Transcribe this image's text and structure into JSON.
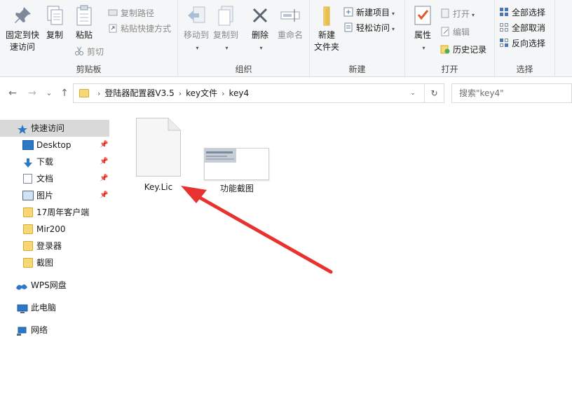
{
  "ribbon": {
    "clipboard": {
      "label": "剪贴板",
      "pin_label_1": "固定到快",
      "pin_label_2": "速访问",
      "copy": "复制",
      "paste": "粘贴",
      "copy_path": "复制路径",
      "paste_shortcut": "粘贴快捷方式",
      "cut": "剪切"
    },
    "organize": {
      "label": "组织",
      "move_to": "移动到",
      "copy_to": "复制到",
      "delete": "删除",
      "rename": "重命名"
    },
    "new": {
      "label": "新建",
      "new_folder_1": "新建",
      "new_folder_2": "文件夹",
      "new_item": "新建项目",
      "easy_access": "轻松访问"
    },
    "open": {
      "label": "打开",
      "properties": "属性",
      "open": "打开",
      "edit": "编辑",
      "history": "历史记录"
    },
    "select": {
      "label": "选择",
      "select_all": "全部选择",
      "select_none": "全部取消",
      "invert": "反向选择"
    }
  },
  "nav": {
    "back": "←",
    "forward": "→",
    "recent": "⌄",
    "up": "↑",
    "breadcrumbs": [
      "登陆器配置器V3.5",
      "key文件",
      "key4"
    ],
    "search_placeholder": "搜索\"key4\""
  },
  "sidebar": {
    "items": [
      {
        "label": "快速访问",
        "icon": "star-icon",
        "selected": true
      },
      {
        "label": "Desktop",
        "icon": "desktop-icon",
        "pinned": true
      },
      {
        "label": "下载",
        "icon": "download-icon",
        "pinned": true
      },
      {
        "label": "文档",
        "icon": "document-icon",
        "pinned": true
      },
      {
        "label": "图片",
        "icon": "picture-icon",
        "pinned": true
      },
      {
        "label": "17周年客户端",
        "icon": "folder-icon"
      },
      {
        "label": "Mir200",
        "icon": "folder-icon"
      },
      {
        "label": "登录器",
        "icon": "folder-icon"
      },
      {
        "label": "截图",
        "icon": "folder-icon"
      },
      {
        "label": "WPS网盘",
        "icon": "cloud-icon"
      },
      {
        "label": "此电脑",
        "icon": "computer-icon"
      },
      {
        "label": "网络",
        "icon": "network-icon"
      }
    ]
  },
  "files": [
    {
      "name": "Key.Lic",
      "icon": "blank-document-icon"
    },
    {
      "name": "功能截图",
      "icon": "image-thumbnail-icon"
    }
  ],
  "colors": {
    "ribbon_bg": "#f5f6f7",
    "selected_bg": "#d9d9d9",
    "folder": "#f8d775",
    "annotation_arrow": "#e8322f"
  }
}
